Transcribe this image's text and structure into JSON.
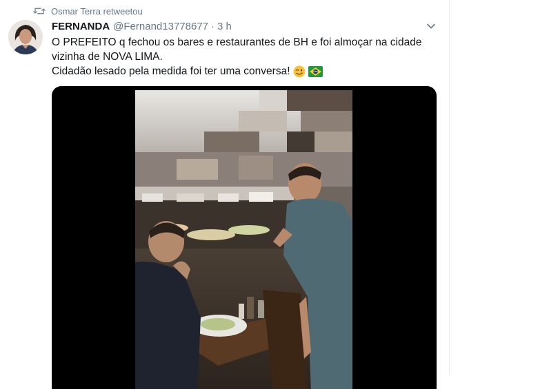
{
  "retweet": {
    "text": "Osmar Terra retweetou",
    "icon": "retweet-icon"
  },
  "tweet": {
    "author_name": "FERNANDA",
    "author_handle": "@Fernand13778677",
    "separator": "·",
    "time": "3 h",
    "lines": [
      "O PREFEITO q fechou os bares e restaurantes de BH e foi almoçar na cidade",
      "vizinha de NOVA LIMA.",
      "Cidadão lesado pela medida foi ter uma conversa!"
    ],
    "emojis": [
      "winking-face-emoji",
      "brazil-flag-emoji"
    ]
  },
  "colors": {
    "text": "#14171a",
    "secondary": "#657786",
    "media_bg": "#000000",
    "divider": "#e6ecf0"
  }
}
